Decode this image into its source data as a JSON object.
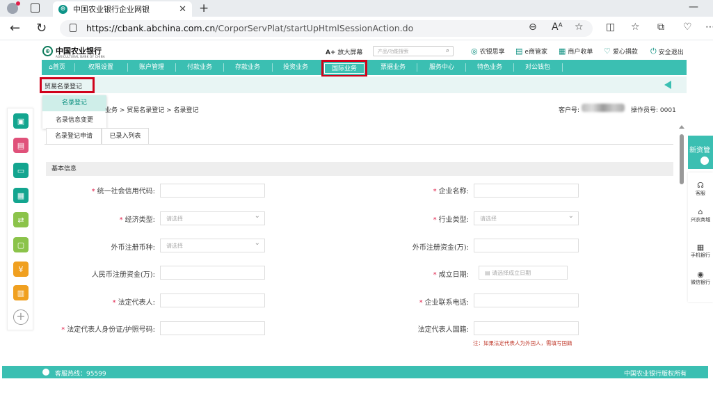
{
  "browser": {
    "tab_title": "中国农业银行企业网银",
    "tab_favicon": "abc-logo-icon",
    "new_tab": "+",
    "minimize": "—",
    "url_prefix": "https://cbank.abchina.com.cn",
    "url_path": "/CorporServPlat/startUpHtmlSessionAction.do"
  },
  "header": {
    "logo_cn": "中国农业银行",
    "logo_en": "AGRICULTURAL BANK OF CHINA",
    "zoom_label": "放大屏幕",
    "zoom_prefix": "A+",
    "search_placeholder": "产品/功能搜索",
    "links": [
      "农银思享",
      "e商管家",
      "商户收单",
      "爱心捐款",
      "安全退出"
    ]
  },
  "nav": {
    "items": [
      "首页",
      "权限设置",
      "账户管理",
      "付款业务",
      "存款业务",
      "投资业务",
      "国际业务",
      "票据业务",
      "服务中心",
      "特色业务",
      "对公钱包"
    ],
    "active": "国际业务"
  },
  "subnav": {
    "selected": "贸易名录登记",
    "dropdown": [
      "名录登记",
      "名录信息变更"
    ]
  },
  "breadcrumb": "业务 > 贸易名录登记 > 名录登记",
  "account": {
    "customer_label": "客户号:",
    "operator_label": "操作员号:",
    "operator_no": "0001"
  },
  "page_tabs": [
    "名录登记申请",
    "已录入列表"
  ],
  "section_title": "基本信息",
  "form": {
    "left": [
      {
        "label": "统一社会信用代码:",
        "required": true,
        "type": "text",
        "value": ""
      },
      {
        "label": "经济类型:",
        "required": true,
        "type": "select",
        "value": "请选择"
      },
      {
        "label": "外币注册币种:",
        "required": false,
        "type": "select",
        "value": "请选择"
      },
      {
        "label": "人民币注册资金(万):",
        "required": false,
        "type": "text",
        "value": ""
      },
      {
        "label": "法定代表人:",
        "required": true,
        "type": "text",
        "value": ""
      },
      {
        "label": "法定代表人身份证/护照号码:",
        "required": true,
        "type": "text",
        "value": ""
      }
    ],
    "right": [
      {
        "label": "企业名称:",
        "required": true,
        "type": "text",
        "value": ""
      },
      {
        "label": "行业类型:",
        "required": true,
        "type": "select",
        "value": "请选择"
      },
      {
        "label": "外币注册资金(万):",
        "required": false,
        "type": "text",
        "value": ""
      },
      {
        "label": "成立日期:",
        "required": true,
        "type": "date",
        "value": "请选择成立日期"
      },
      {
        "label": "企业联系电话:",
        "required": true,
        "type": "text",
        "value": ""
      },
      {
        "label": "法定代表人国籍:",
        "required": false,
        "type": "text",
        "value": ""
      }
    ],
    "note": "注：如果法定代表人为外国人，需填写国籍"
  },
  "right_dock": {
    "top_label": "新资管",
    "items": [
      "客服",
      "兴农商城",
      "手机银行",
      "微信银行"
    ]
  },
  "footer": {
    "hotline": "客服热线：95599",
    "copyright": "中国农业银行版权所有"
  },
  "colors": {
    "brand": "#3bbfb2",
    "highlight": "#d0021b",
    "required": "#e11d48"
  }
}
